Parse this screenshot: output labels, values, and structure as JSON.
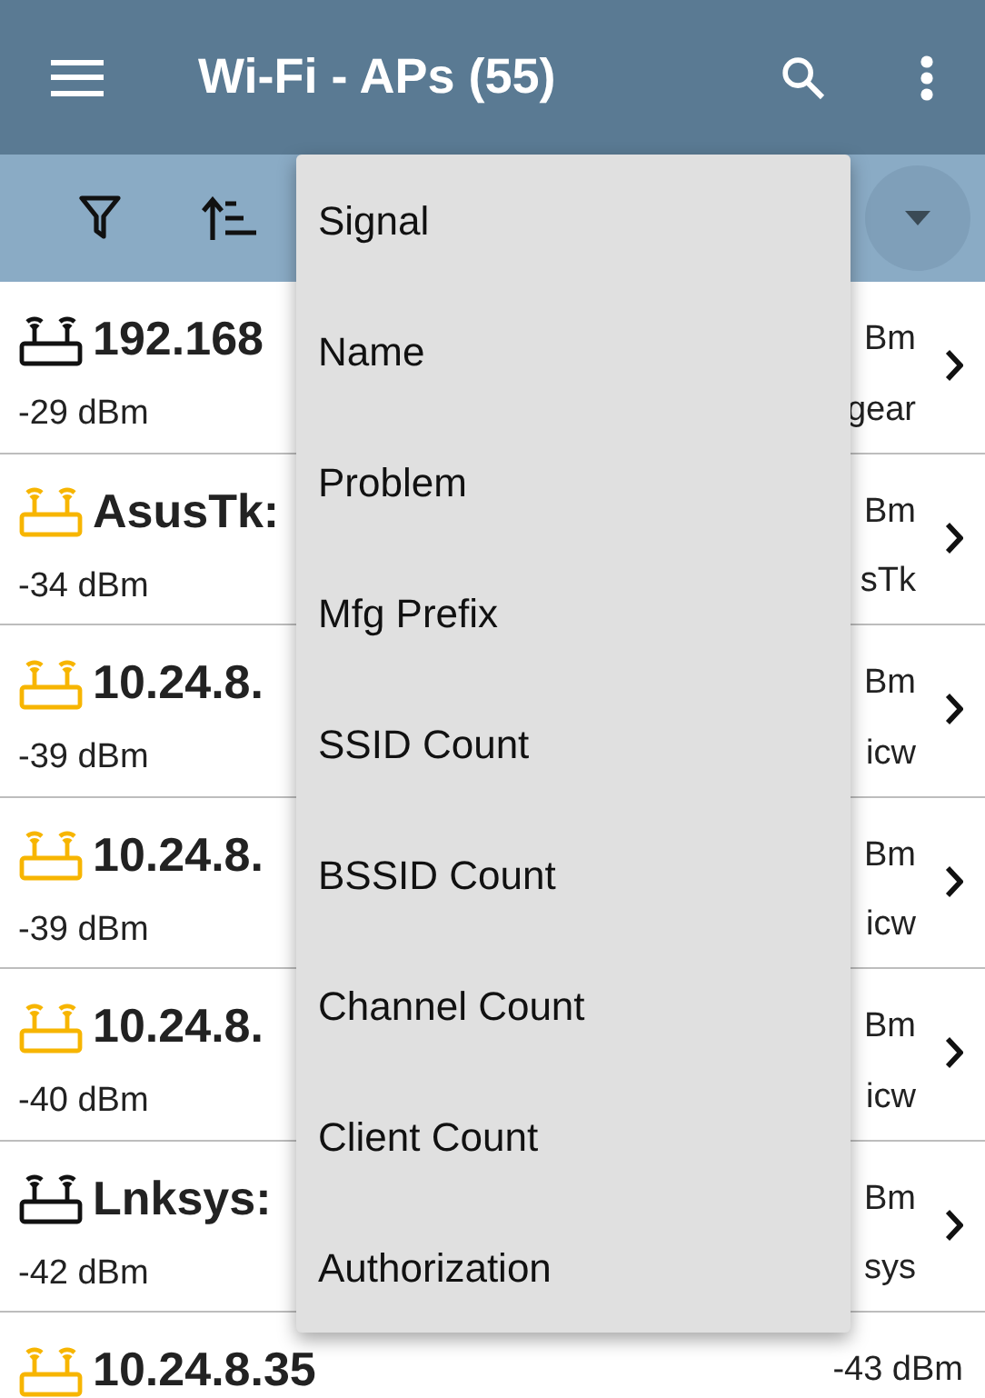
{
  "app_bar": {
    "title": "Wi-Fi - APs (55)"
  },
  "sort_menu": {
    "items": [
      {
        "label": "Signal"
      },
      {
        "label": "Name"
      },
      {
        "label": "Problem"
      },
      {
        "label": "Mfg Prefix"
      },
      {
        "label": "SSID Count"
      },
      {
        "label": "BSSID Count"
      },
      {
        "label": "Channel Count"
      },
      {
        "label": "Client Count"
      },
      {
        "label": "Authorization"
      }
    ]
  },
  "ap_rows": [
    {
      "title": "192.168",
      "signal": "-29 dBm",
      "right_top": "Bm",
      "right_bottom": "gear",
      "color": "#111111"
    },
    {
      "title": "AsusTk:",
      "signal": "-34 dBm",
      "right_top": "Bm",
      "right_bottom": "sTk",
      "color": "#f7b500"
    },
    {
      "title": "10.24.8.",
      "signal": "-39 dBm",
      "right_top": "Bm",
      "right_bottom": "icw",
      "color": "#f7b500"
    },
    {
      "title": "10.24.8.",
      "signal": "-39 dBm",
      "right_top": "Bm",
      "right_bottom": "icw",
      "color": "#f7b500"
    },
    {
      "title": "10.24.8.",
      "signal": "-40 dBm",
      "right_top": "Bm",
      "right_bottom": "icw",
      "color": "#f7b500"
    },
    {
      "title": "Lnksys:",
      "signal": "-42 dBm",
      "right_top": "Bm",
      "right_bottom": "sys",
      "color": "#111111"
    },
    {
      "title": "10.24.8.35",
      "right_top": "-43 dBm",
      "color": "#f7b500"
    }
  ]
}
